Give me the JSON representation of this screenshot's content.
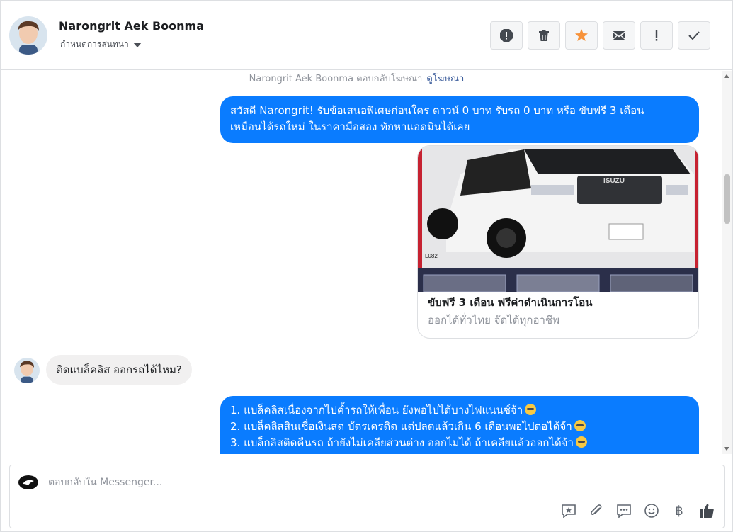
{
  "header": {
    "contact_name": "Narongrit Aek Boonma",
    "assign_label": "กำหนดการสนทนา",
    "actions": [
      {
        "name": "report-icon",
        "label": "!"
      },
      {
        "name": "trash-icon",
        "label": ""
      },
      {
        "name": "star-icon",
        "label": ""
      },
      {
        "name": "mail-icon",
        "label": ""
      },
      {
        "name": "exclamation-icon",
        "label": "!"
      },
      {
        "name": "check-icon",
        "label": ""
      }
    ]
  },
  "thread": {
    "reply_note": "Narongrit Aek Boonma ตอบกลับโฆษณา",
    "reply_link": "ดูโฆษณา",
    "outgoing_1": {
      "line1": "สวัสดี Narongrit! รับข้อเสนอพิเศษก่อนใคร ดาวน์ 0 บาท รับรถ 0 บาท หรือ ขับฟรี 3 เดือน",
      "line2": "เหมือนได้รถใหม่ ในราคามือสอง ทักหาแอดมินได้เลย"
    },
    "ad_card": {
      "title": "ขับฟรี 3 เดือน ฟรีค่าดำเนินการโอน",
      "subtitle": "ออกได้ทั่วไทย จัดได้ทุกอาชีพ",
      "brand_text": "ISUZU",
      "watermark": "L082"
    },
    "incoming_1": "ติดแบล็คลิส ออกรถได้ไหม?",
    "outgoing_2": {
      "line1": "1. แบล็คลิสเนื่องจากไปค้ำรถให้เพื่อน ยังพอไปได้บางไฟแนนซ์จ้า",
      "line2": "2. แบล็คลิสสินเชื่อเงินสด บัตรเครดิต แต่ปลดแล้วเกิน 6 เดือนพอไปต่อได้จ้า",
      "line3": "3. แบล็กลิสติดคืนรถ ถ้ายังไม่เคลียส่วนต่าง ออกไม่ได้ ถ้าเคลียแล้วออกได้จ้า"
    }
  },
  "composer": {
    "placeholder": "ตอบกลับใน Messenger...",
    "tools": [
      "saved-reply-icon",
      "attachment-icon",
      "chat-icon",
      "emoji-icon",
      "baht-icon",
      "like-icon"
    ],
    "baht_symbol": "฿"
  },
  "colors": {
    "accent_blue": "#0a7cff",
    "incoming_bg": "#f1f0f0",
    "star_orange": "#f7923a"
  }
}
